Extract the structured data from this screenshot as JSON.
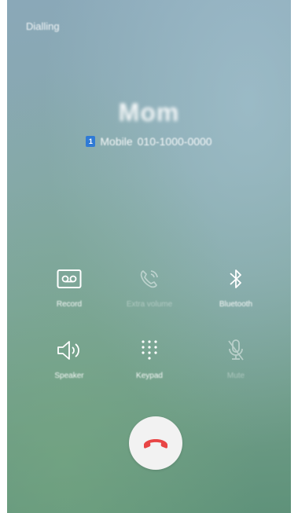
{
  "call": {
    "status": "Dialling",
    "name": "Mom",
    "sim": "1",
    "line_type": "Mobile",
    "number": "010-1000-0000"
  },
  "controls": [
    {
      "label": "Record",
      "icon": "voicemail-icon",
      "enabled": true
    },
    {
      "label": "Extra volume",
      "icon": "extra-volume-icon",
      "enabled": false
    },
    {
      "label": "Bluetooth",
      "icon": "bluetooth-icon",
      "enabled": true
    },
    {
      "label": "Speaker",
      "icon": "speaker-icon",
      "enabled": true
    },
    {
      "label": "Keypad",
      "icon": "keypad-icon",
      "enabled": true
    },
    {
      "label": "Mute",
      "icon": "mic-off-icon",
      "enabled": false
    }
  ],
  "end_call": {
    "icon": "phone-hangup-icon",
    "color": "#e84545"
  },
  "colors": {
    "text": "#ffffff",
    "sim_badge": "#2f7ad6",
    "end_button_bg": "#f2f2f2"
  }
}
